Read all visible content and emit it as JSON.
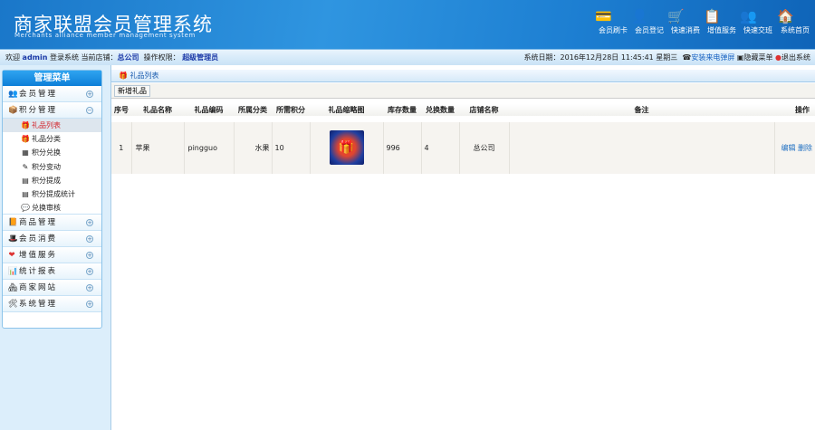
{
  "header": {
    "title": "商家联盟会员管理系统",
    "subtitle": "Merchants alliance member management system",
    "toolbar": [
      {
        "label": "会员刷卡",
        "icon": "card-icon"
      },
      {
        "label": "会员登记",
        "icon": "user-icon"
      },
      {
        "label": "快速消费",
        "icon": "cart-icon"
      },
      {
        "label": "增值服务",
        "icon": "document-icon"
      },
      {
        "label": "快速交班",
        "icon": "users-swap-icon"
      },
      {
        "label": "系统首页",
        "icon": "home-icon"
      }
    ]
  },
  "infobar": {
    "welcome": "欢迎",
    "user": "admin",
    "login": "登录系统",
    "store_label": "当前店铺：",
    "store": "总公司",
    "perm_label": "操作权限：",
    "perm": "超级管理员",
    "date": "系统日期：2016年12月28日 11:45:41 星期三",
    "install_popup": "安装来电弹屏",
    "hide_menu": "隐藏菜单",
    "logout": "退出系统"
  },
  "sidebar": {
    "title": "管理菜单",
    "groups": [
      {
        "label": "会员管理",
        "icon": "👥",
        "toggle": "+"
      },
      {
        "label": "积分管理",
        "icon": "📦",
        "toggle": "−",
        "items": [
          "礼品列表",
          "礼品分类",
          "积分兑换",
          "积分变动",
          "积分提成",
          "积分提成统计",
          "兑换审核"
        ]
      },
      {
        "label": "商品管理",
        "icon": "📙",
        "toggle": "+"
      },
      {
        "label": "会员消费",
        "icon": "🎩",
        "toggle": "+"
      },
      {
        "label": "增值服务",
        "icon": "❤",
        "toggle": "+"
      },
      {
        "label": "统计报表",
        "icon": "📊",
        "toggle": "+"
      },
      {
        "label": "商家网站",
        "icon": "🏘",
        "toggle": "+"
      },
      {
        "label": "系统管理",
        "icon": "🛠",
        "toggle": "+"
      }
    ]
  },
  "main": {
    "title": "礼品列表",
    "add_button": "新增礼品",
    "columns": [
      "序号",
      "礼品名称",
      "礼品编码",
      "所属分类",
      "所需积分",
      "礼品缩略图",
      "库存数量",
      "兑换数量",
      "店铺名称",
      "备注",
      "操作"
    ],
    "rows": [
      {
        "no": "1",
        "name": "苹果",
        "code": "pingguo",
        "category": "水果",
        "points": "10",
        "stock": "996",
        "exchanged": "4",
        "store": "总公司",
        "remark": "",
        "edit": "编辑",
        "delete": "删除"
      }
    ]
  }
}
